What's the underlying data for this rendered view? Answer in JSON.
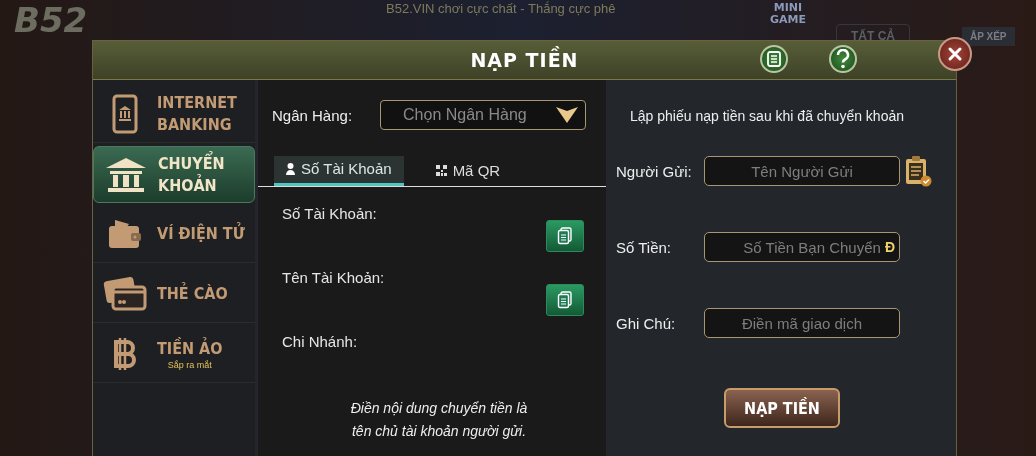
{
  "background": {
    "logo": "B52",
    "marquee": "B52.VIN chơi cực chất - Thắng cực phê",
    "mini_game": "MINI GAME",
    "filter": "TẤT CẢ",
    "sort": "ẮP XẾP"
  },
  "dialog": {
    "title": "NẠP TIỀN"
  },
  "methods": [
    {
      "label": "INTERNET\nBANKING",
      "kind": "phone-bank",
      "selected": false
    },
    {
      "label": "CHUYỂN\nKHOẢN",
      "kind": "bank",
      "selected": true
    },
    {
      "label": "VÍ ĐIỆN TỬ",
      "kind": "wallet",
      "selected": false
    },
    {
      "label": "THẺ CÀO",
      "kind": "card",
      "selected": false
    },
    {
      "label": "TIỀN ẢO",
      "kind": "bitcoin",
      "selected": false,
      "note": "Sắp ra mắt"
    }
  ],
  "bank": {
    "label": "Ngân Hàng:",
    "placeholder": "Chọn Ngân Hàng"
  },
  "tabs": [
    {
      "label": "Số Tài Khoản",
      "kind": "account",
      "selected": true
    },
    {
      "label": "Mã QR",
      "kind": "qr",
      "selected": false
    }
  ],
  "details": [
    {
      "label": "Số Tài Khoản:",
      "copyable": true
    },
    {
      "label": "Tên Tài Khoản:",
      "copyable": true
    },
    {
      "label": "Chi Nhánh:",
      "copyable": false
    }
  ],
  "note": "Điền nội dung chuyển tiền là\ntên chủ tài khoản người gửi.",
  "form": {
    "heading": "Lập phiếu nạp tiền sau khi đã chuyển khoản",
    "fields": [
      {
        "label": "Người Gửi:",
        "placeholder": "Tên Người Gửi",
        "kind": "name"
      },
      {
        "label": "Số Tiền:",
        "placeholder": "Số Tiền Bạn Chuyển",
        "kind": "amount",
        "suffix": "Đ"
      },
      {
        "label": "Ghi Chú:",
        "placeholder": "Điền mã giao dịch",
        "kind": "text"
      }
    ],
    "submit": "NẠP TIỀN"
  }
}
